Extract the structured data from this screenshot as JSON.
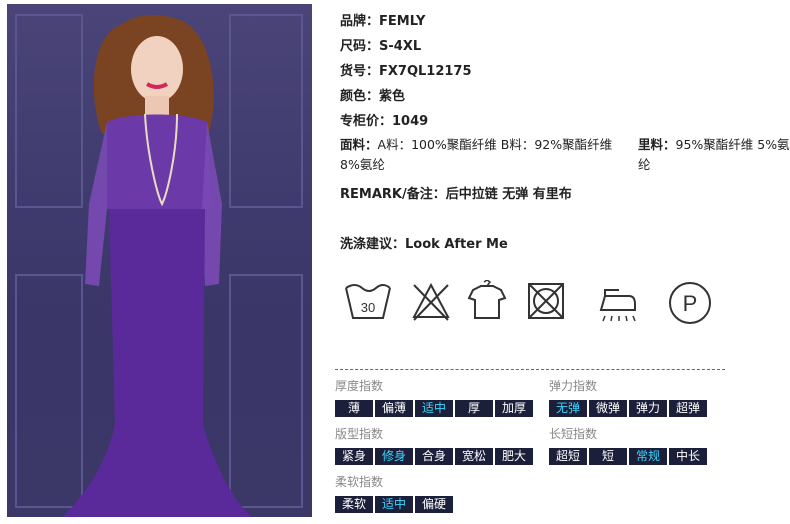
{
  "product": {
    "brand_label": "品牌：",
    "brand": "FEMLY",
    "size_label": "尺码：",
    "size": "S-4XL",
    "sku_label": "货号：",
    "sku": "FX7QL12175",
    "color_label": "颜色：",
    "color": "紫色",
    "price_label": "专柜价：",
    "price": "1049",
    "fabric_label": "面料：",
    "fabric_a": "A料：100%聚酯纤维 B料：92%聚酯纤维 8%氨纶",
    "lining_label": "里料：",
    "lining": "95%聚酯纤维 5%氨纶",
    "remark_label": "REMARK/备注：",
    "remark": "后中拉链 无弹 有里布",
    "wash_label": "洗涤建议：",
    "wash": "Look After Me"
  },
  "care_icons": [
    {
      "name": "wash-30-icon",
      "text": "30"
    },
    {
      "name": "no-bleach-icon"
    },
    {
      "name": "hang-dry-icon"
    },
    {
      "name": "no-tumble-dry-icon"
    },
    {
      "name": "iron-steam-icon"
    },
    {
      "name": "dry-clean-p-icon",
      "text": "P"
    }
  ],
  "indices": {
    "thickness": {
      "title": "厚度指数",
      "options": [
        "薄",
        "偏薄",
        "适中",
        "厚",
        "加厚"
      ],
      "selected": "适中"
    },
    "elasticity": {
      "title": "弹力指数",
      "options": [
        "无弹",
        "微弹",
        "弹力",
        "超弹"
      ],
      "selected": "无弹"
    },
    "fit": {
      "title": "版型指数",
      "options": [
        "紧身",
        "修身",
        "合身",
        "宽松",
        "肥大"
      ],
      "selected": "修身"
    },
    "length": {
      "title": "长短指数",
      "options": [
        "超短",
        "短",
        "常规",
        "中长"
      ],
      "selected": "常规"
    },
    "softness": {
      "title": "柔软指数",
      "options": [
        "柔软",
        "适中",
        "偏硬"
      ],
      "selected": "适中"
    }
  },
  "colors": {
    "dress": "#5a2a9a",
    "tag_bg": "#1c1f3a",
    "tag_selected": "#3ad6ff"
  }
}
